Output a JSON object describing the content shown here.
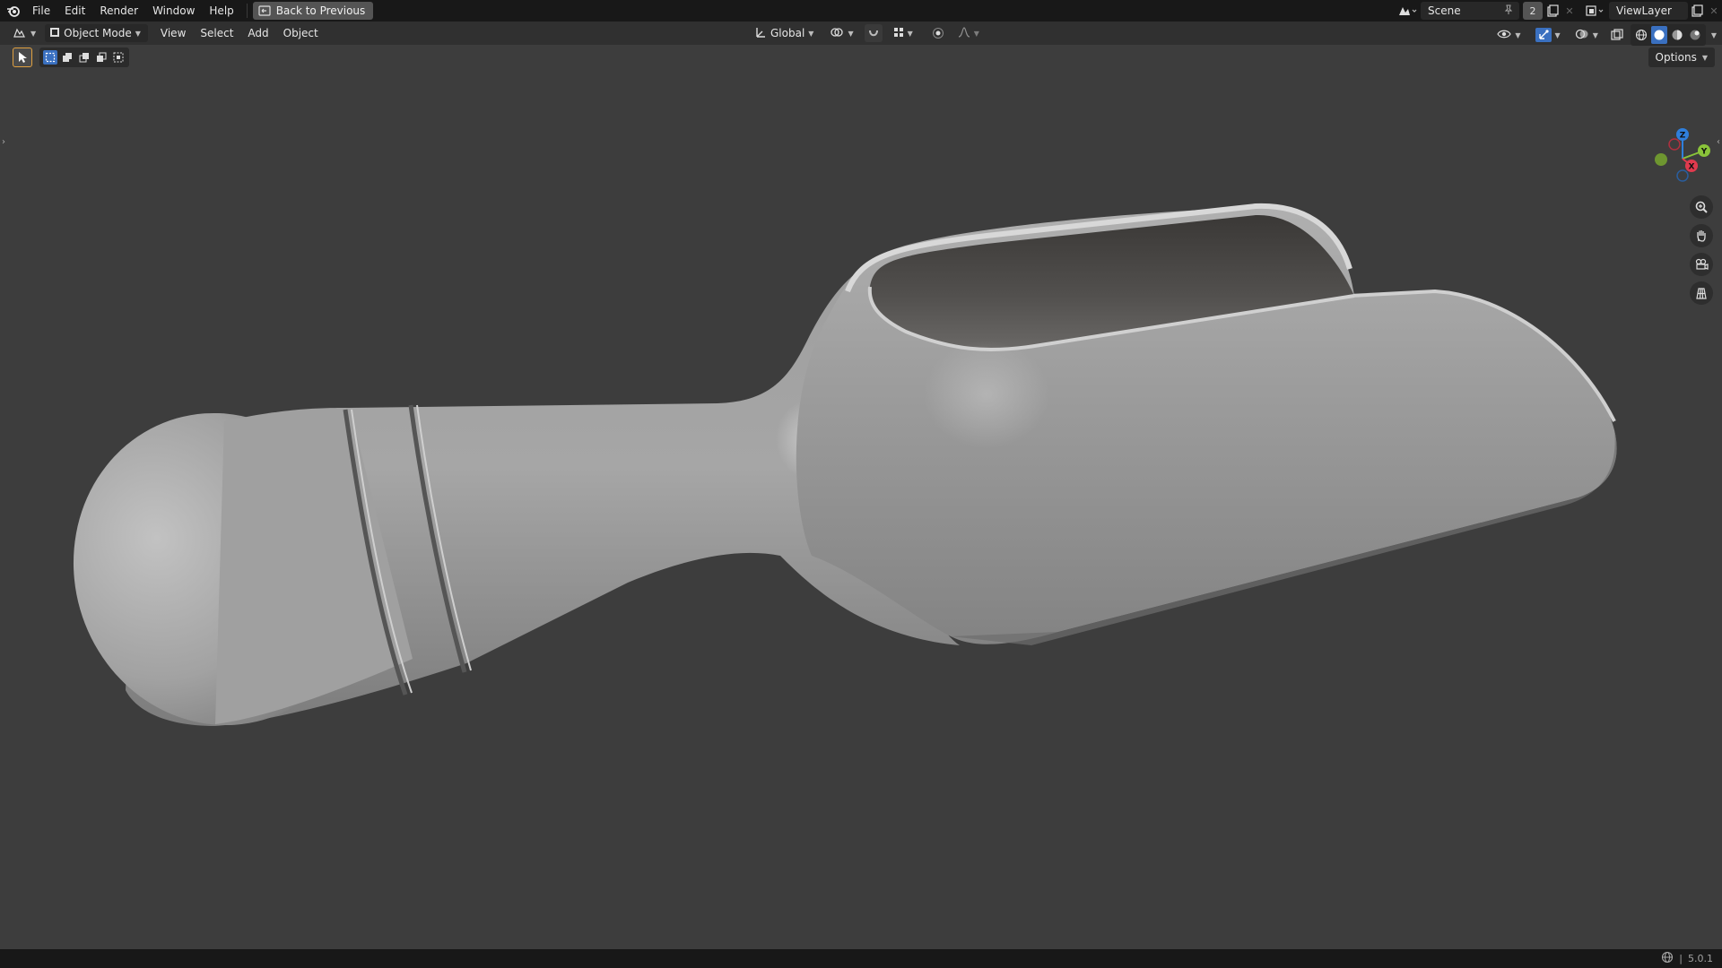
{
  "menu": {
    "file": "File",
    "edit": "Edit",
    "render": "Render",
    "window": "Window",
    "help": "Help",
    "back_button": "Back to Previous"
  },
  "top_right": {
    "scene_name": "Scene",
    "scene_count": "2",
    "view_layer": "ViewLayer"
  },
  "header": {
    "mode": "Object Mode",
    "view": "View",
    "select": "Select",
    "add": "Add",
    "object": "Object",
    "transform_orientation": "Global"
  },
  "toolrow": {
    "options": "Options"
  },
  "gizmo": {
    "z": "Z",
    "y": "Y",
    "x": "X",
    "z_color": "#2f7fdc",
    "y_color": "#8ac43a",
    "x_color": "#e03a4e"
  },
  "icons": [
    "blender-logo-icon",
    "back-icon",
    "editor-type-icon",
    "object-mode-icon",
    "transform-orientation-icon",
    "pivot-icon",
    "snap-icon",
    "snap-grid-icon",
    "proportional-edit-icon",
    "falloff-icon",
    "visibility-icon",
    "gizmo-icon",
    "overlay-icon",
    "xray-icon",
    "wireframe-shading-icon",
    "solid-shading-icon",
    "material-shading-icon",
    "rendered-shading-icon",
    "zoom-icon",
    "pan-hand-icon",
    "camera-view-icon",
    "ortho-grid-icon",
    "globe-icon"
  ],
  "status": {
    "version": "5.0.1"
  },
  "colors": {
    "topbar_bg": "#181818",
    "header_bg": "#303030",
    "viewport_bg": "#3d3d3d",
    "accent": "#3a70c0",
    "model_gray": "#9a9a9a"
  }
}
